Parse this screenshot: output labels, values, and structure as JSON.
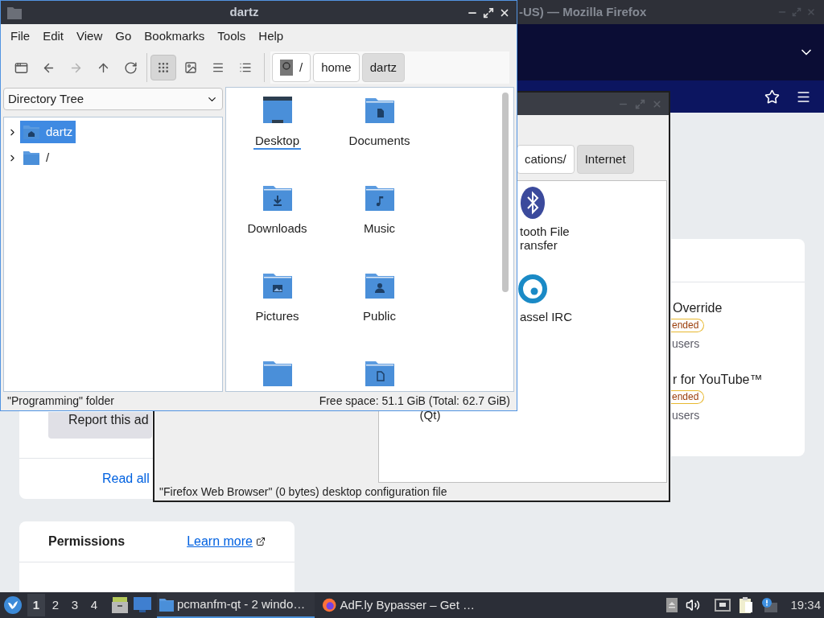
{
  "browser": {
    "title": "-US) — Mozilla Firefox",
    "addons": [
      {
        "name": "Override",
        "badge": "ended",
        "users": "users"
      },
      {
        "name": "r for YouTube™",
        "badge": "ended",
        "users": "users"
      }
    ],
    "report_button": "Report this ad",
    "read_all_link": "Read all",
    "permissions": {
      "title": "Permissions",
      "link": "Learn more"
    }
  },
  "back_window": {
    "path": [
      {
        "label": "cations/",
        "selected": false
      },
      {
        "label": "Internet",
        "selected": true
      }
    ],
    "apps": [
      {
        "kind": "bluetooth",
        "label": "tooth File\nransfer"
      },
      {
        "kind": "ring",
        "label": "assel IRC"
      },
      {
        "kind": "text",
        "label": "(Qt)"
      }
    ],
    "status": "\"Firefox Web Browser\" (0 bytes) desktop configuration file"
  },
  "window": {
    "title": "dartz",
    "menu": [
      "File",
      "Edit",
      "View",
      "Go",
      "Bookmarks",
      "Tools",
      "Help"
    ],
    "nav": [
      {
        "kind": "new-tab",
        "disabled": false
      },
      {
        "kind": "back",
        "disabled": false
      },
      {
        "kind": "forward",
        "disabled": true
      },
      {
        "kind": "up",
        "disabled": false
      },
      {
        "kind": "reload",
        "disabled": false
      }
    ],
    "view_modes": [
      {
        "kind": "icons",
        "selected": true
      },
      {
        "kind": "thumbnails",
        "selected": false
      },
      {
        "kind": "compact",
        "selected": false
      },
      {
        "kind": "details",
        "selected": false
      }
    ],
    "path": [
      {
        "kind": "root",
        "label": "/",
        "selected": false
      },
      {
        "kind": "dir",
        "label": "home",
        "selected": false
      },
      {
        "kind": "dir",
        "label": "dartz",
        "selected": true
      }
    ],
    "side_pane": {
      "mode": "Directory Tree",
      "tree": [
        {
          "kind": "home",
          "label": "dartz",
          "selected": true,
          "expanded": false
        },
        {
          "kind": "folder",
          "label": "/",
          "selected": false,
          "expanded": false
        }
      ]
    },
    "files": [
      {
        "kind": "desktop",
        "label": "Desktop",
        "focused": true
      },
      {
        "kind": "documents",
        "label": "Documents",
        "focused": false
      },
      {
        "kind": "downloads",
        "label": "Downloads",
        "focused": false
      },
      {
        "kind": "music",
        "label": "Music",
        "focused": false
      },
      {
        "kind": "pictures",
        "label": "Pictures",
        "focused": false
      },
      {
        "kind": "public",
        "label": "Public",
        "focused": false
      },
      {
        "kind": "folder"
      },
      {
        "kind": "document-folder"
      }
    ],
    "status_left": "\"Programming\" folder",
    "status_right": "Free space: 51.1 GiB (Total: 62.7 GiB)"
  },
  "taskbar": {
    "workspaces": [
      {
        "label": "1",
        "selected": true
      },
      {
        "label": "2",
        "selected": false
      },
      {
        "label": "3",
        "selected": false
      },
      {
        "label": "4",
        "selected": false
      }
    ],
    "tasks": [
      {
        "kind": "folder",
        "label": "pcmanfm-qt - 2 windo…",
        "selected": true
      },
      {
        "kind": "browser",
        "label": "AdF.ly Bypasser – Get …",
        "selected": false
      }
    ],
    "clock": "19:34"
  }
}
